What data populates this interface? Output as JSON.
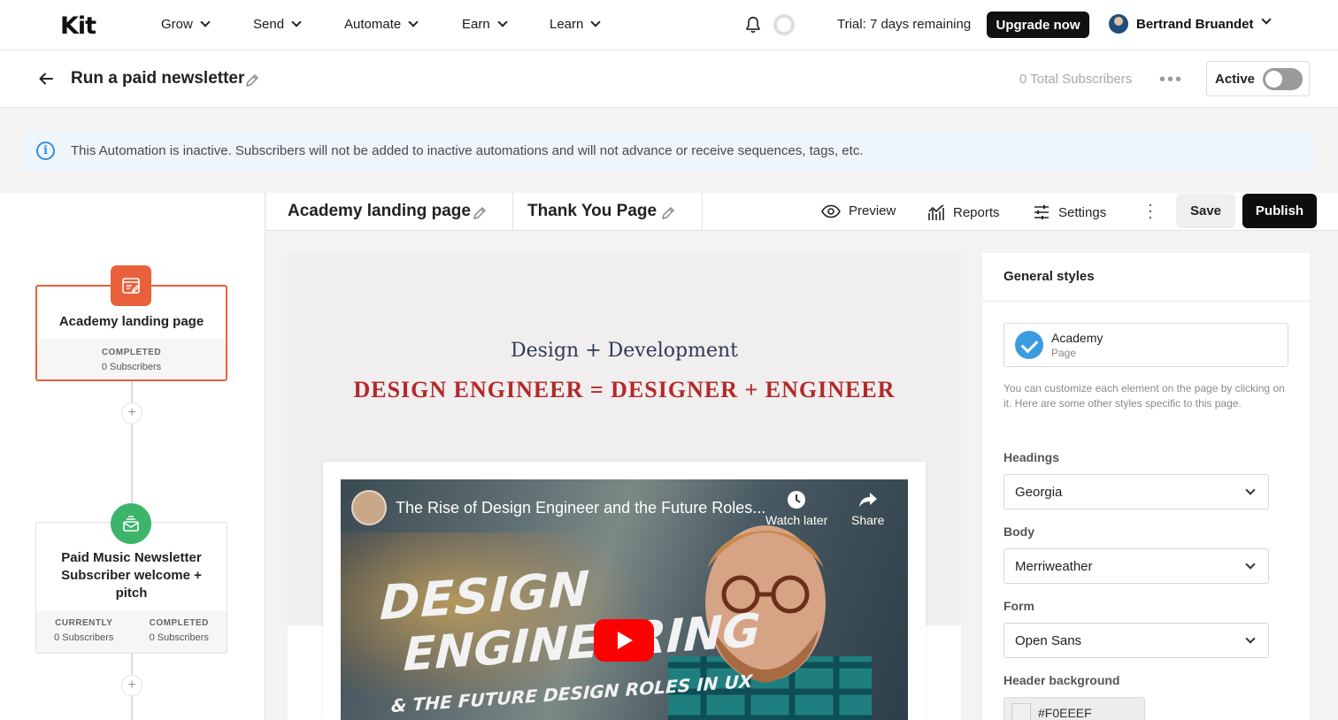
{
  "nav": {
    "logo": "Kit",
    "items": [
      "Grow",
      "Send",
      "Automate",
      "Earn",
      "Learn"
    ],
    "trial_text": "Trial: 7 days remaining",
    "upgrade_label": "Upgrade now",
    "user_name": "Bertrand Bruandet"
  },
  "header": {
    "title": "Run a paid newsletter",
    "total_subscribers": "0 Total Subscribers",
    "active_label": "Active"
  },
  "banner": {
    "text": "This Automation is inactive. Subscribers will not be added to inactive automations and will not advance or receive sequences, tags, etc."
  },
  "flow": {
    "node1": {
      "title": "Academy landing page",
      "foot_label": "COMPLETED",
      "foot_value": "0 Subscribers"
    },
    "node2": {
      "title": "Paid Music Newsletter Subscriber welcome + pitch",
      "currently_label": "CURRENTLY",
      "currently_value": "0 Subscribers",
      "completed_label": "COMPLETED",
      "completed_value": "0 Subscribers"
    }
  },
  "tabs": {
    "tab1": "Academy landing page",
    "tab2": "Thank You Page",
    "preview": "Preview",
    "reports": "Reports",
    "settings": "Settings",
    "save": "Save",
    "publish": "Publish"
  },
  "canvas": {
    "subtitle": "Design + Development",
    "headline": "DESIGN ENGINEER = DESIGNER + ENGINEER",
    "video": {
      "title": "The Rise of Design Engineer and the Future Roles...",
      "watch_later": "Watch later",
      "share": "Share",
      "thumb_line1": "DESIGN",
      "thumb_line2": "ENGINEERING",
      "thumb_line3": "& THE FUTURE DESIGN ROLES IN UX"
    }
  },
  "styles": {
    "title": "General styles",
    "template_name": "Academy",
    "template_sub": "Page",
    "help": "You can customize each element on the page by clicking on it. Here are some other styles specific to this page.",
    "headings_label": "Headings",
    "headings_value": "Georgia",
    "body_label": "Body",
    "body_value": "Merriweather",
    "form_label": "Form",
    "form_value": "Open Sans",
    "header_bg_label": "Header background",
    "header_bg_value": "#F0EEEF"
  },
  "colors": {
    "brand_orange": "#e8613a",
    "brand_green": "#3cb56b",
    "headline_red": "#b22a2a",
    "header_bg": "#f0eeef"
  },
  "icons": [
    "bell-icon",
    "back-arrow-icon",
    "pencil-icon",
    "info-icon",
    "eye-icon",
    "reports-icon",
    "settings-sliders-icon",
    "landing-page-icon",
    "email-sequence-icon",
    "clock-icon",
    "share-icon",
    "youtube-play-icon",
    "check-icon"
  ]
}
